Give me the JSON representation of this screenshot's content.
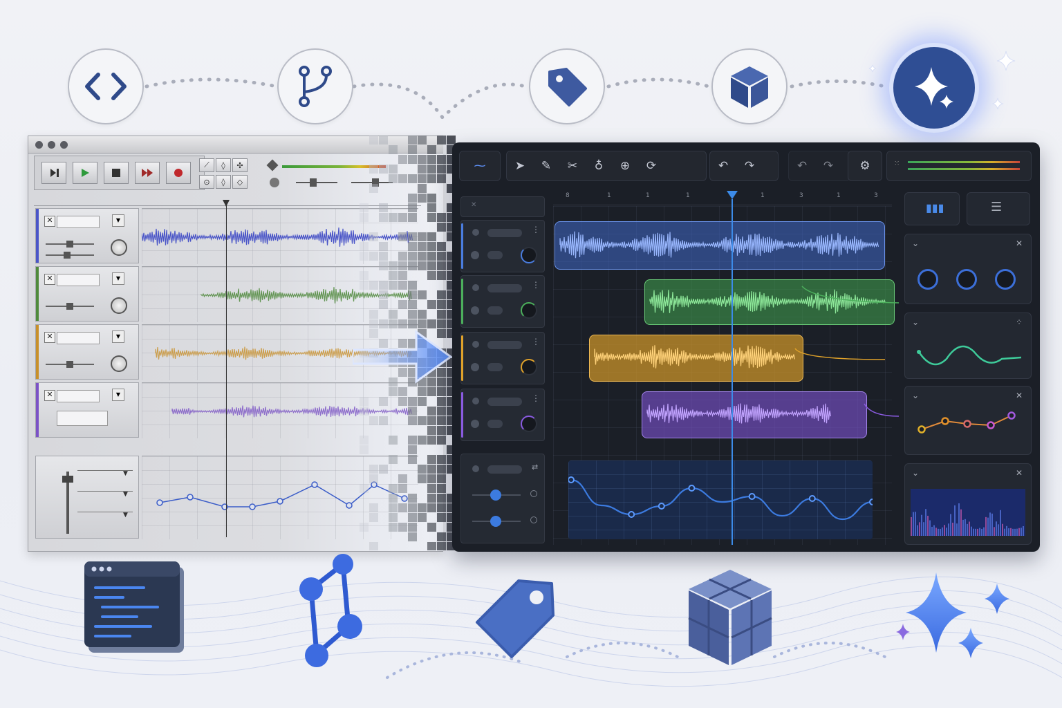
{
  "top_icons": [
    {
      "icon": "code-brackets-icon"
    },
    {
      "icon": "branch-icon"
    },
    {
      "icon": "tag-icon"
    },
    {
      "icon": "cube-icon"
    },
    {
      "icon": "sparkle-icon"
    }
  ],
  "bottom_icons": [
    {
      "icon": "code-window-icon"
    },
    {
      "icon": "graph-nodes-icon"
    },
    {
      "icon": "tag-icon"
    },
    {
      "icon": "blocks-icon"
    },
    {
      "icon": "sparkles-icon"
    }
  ],
  "classic_daw": {
    "transport": [
      "skip-icon",
      "play-icon",
      "stop-icon",
      "fast-forward-icon",
      "record-icon"
    ],
    "tracks": [
      {
        "color": "#4a55c8"
      },
      {
        "color": "#4f8a3c"
      },
      {
        "color": "#c8902a"
      },
      {
        "color": "#7b52c6"
      }
    ]
  },
  "modern_daw": {
    "ruler_ticks": [
      "8",
      "1",
      "1",
      "1",
      "",
      "1",
      "3",
      "1",
      "3"
    ],
    "tracks": [
      {
        "color": "#4a7de0"
      },
      {
        "color": "#4caf5c"
      },
      {
        "color": "#e0a22a"
      },
      {
        "color": "#8a5be0"
      }
    ],
    "clips": [
      {
        "color": "#3f67c8"
      },
      {
        "color": "#3f9a4c"
      },
      {
        "color": "#c9932a"
      },
      {
        "color": "#7650c6"
      }
    ],
    "automation_points": [
      0.82,
      0.45,
      0.32,
      0.44,
      0.7,
      0.5,
      0.58,
      0.3,
      0.55,
      0.25,
      0.5
    ],
    "accent": "#3c7be0"
  }
}
